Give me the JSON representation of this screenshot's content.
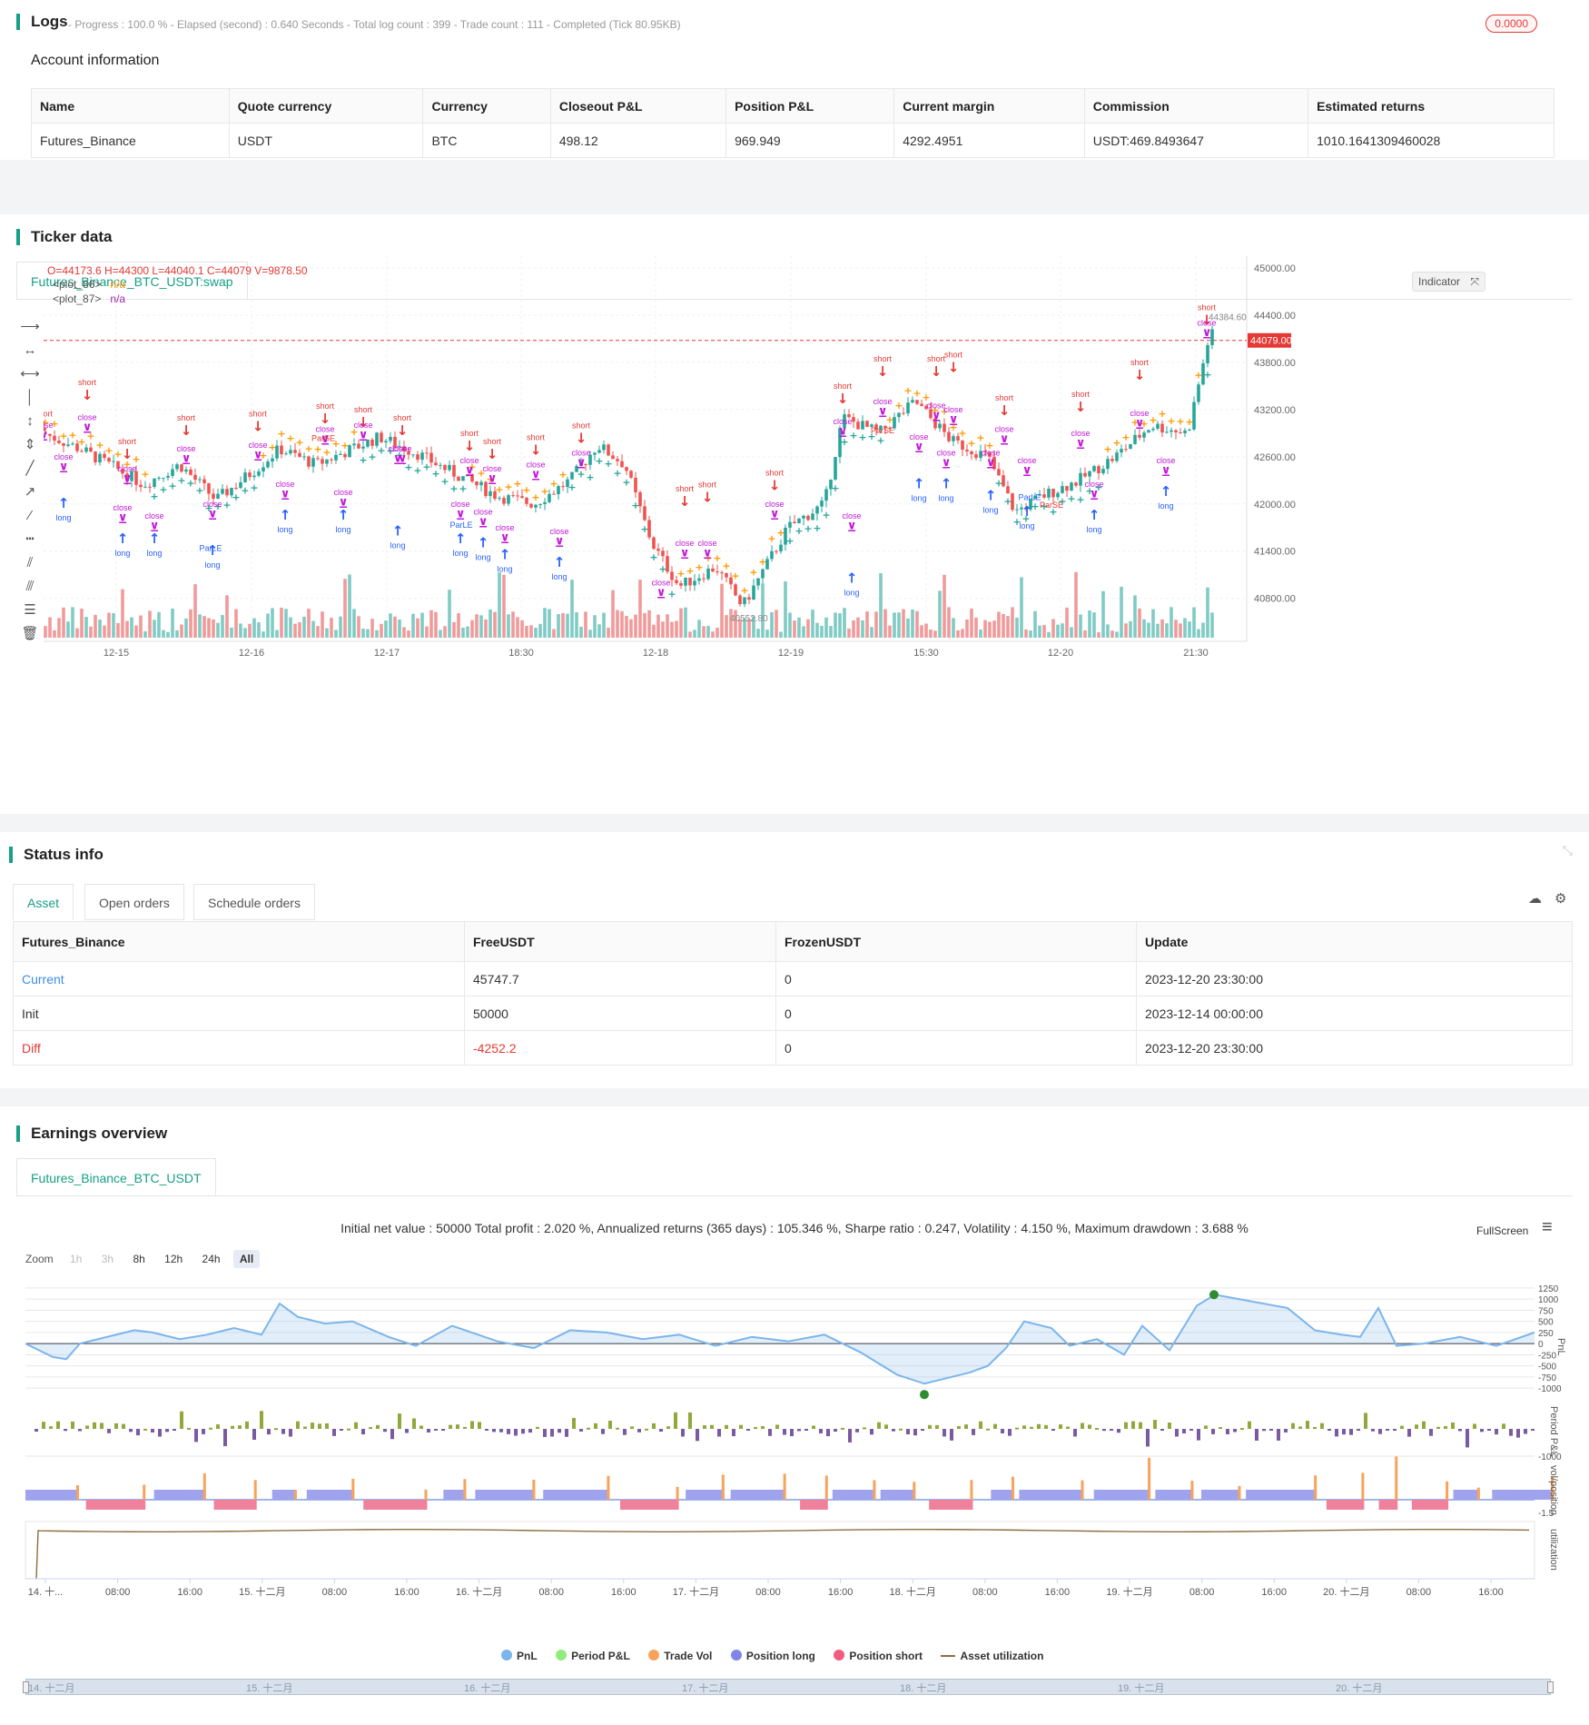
{
  "logs": {
    "title": "Logs",
    "status_line": "- Progress : 100.0 % - Elapsed (second) : 0.640  Seconds - Total log count : 399 - Trade count : 111 - Completed (Tick 80.95KB)",
    "badge": "0.0000"
  },
  "account": {
    "title": "Account information",
    "headers": [
      "Name",
      "Quote currency",
      "Currency",
      "Closeout P&L",
      "Position P&L",
      "Current margin",
      "Commission",
      "Estimated returns"
    ],
    "row": [
      "Futures_Binance",
      "USDT",
      "BTC",
      "498.12",
      "969.949",
      "4292.4951",
      "USDT:469.8493647",
      "1010.1641309460028"
    ]
  },
  "ticker": {
    "title": "Ticker data",
    "tab": "Futures_Binance_BTC_USDT:swap",
    "ohlc": "O=44173.6 H=44300 L=44040.1 C=44079 V=9878.50",
    "plots": [
      {
        "name": "<plot_86>",
        "value": "n/a",
        "color": "#ff9800"
      },
      {
        "name": "<plot_87>",
        "value": "n/a",
        "color": "#9c27b0"
      }
    ],
    "indicator_btn": "Indicator",
    "current_price": "44079.00",
    "high_label": "44384.60",
    "low_label": "40552.80",
    "price_ticks": [
      "45000.00",
      "44400.00",
      "43800.00",
      "43200.00",
      "42600.00",
      "42000.00",
      "41400.00",
      "40800.00"
    ],
    "time_ticks": [
      "12-15",
      "12-16",
      "12-17",
      "18:30",
      "12-18",
      "12-19",
      "15:30",
      "12-20",
      "21:30"
    ],
    "colors": {
      "up": "#26a69a",
      "down": "#ef5350",
      "sar_long": "#26a69a",
      "sar_short": "#ff9800",
      "long": "#2962ff",
      "short": "#e53935",
      "close": "#c118d6"
    },
    "signal_labels": {
      "long": "long",
      "short": "short",
      "close": "close",
      "parle": "ParLE",
      "parse": "ParSE"
    }
  },
  "status": {
    "title": "Status info",
    "tabs": [
      "Asset",
      "Open orders",
      "Schedule orders"
    ],
    "headers": [
      "Futures_Binance",
      "FreeUSDT",
      "FrozenUSDT",
      "Update"
    ],
    "rows": [
      {
        "label": "Current",
        "free": "45747.7",
        "frozen": "0",
        "update": "2023-12-20 23:30:00"
      },
      {
        "label": "Init",
        "free": "50000",
        "frozen": "0",
        "update": "2023-12-14 00:00:00"
      },
      {
        "label": "Diff",
        "free": "-4252.2",
        "frozen": "0",
        "update": "2023-12-20 23:30:00"
      }
    ]
  },
  "earnings": {
    "title": "Earnings overview",
    "tab": "Futures_Binance_BTC_USDT",
    "summary": "Initial net value : 50000 Total profit : 2.020 %, Annualized returns (365 days) : 105.346 %, Sharpe ratio : 0.247, Volatility : 4.150 %, Maximum drawdown : 3.688 %",
    "fullscreen": "FullScreen",
    "zoom_label": "Zoom",
    "zoom_buttons": [
      "1h",
      "3h",
      "8h",
      "12h",
      "24h",
      "All"
    ],
    "pnl_ticks": [
      "1250",
      "1000",
      "750",
      "500",
      "250",
      "0",
      "-250",
      "-500",
      "-750",
      "-1000"
    ],
    "period_tick": "-1000",
    "vol_tick": "-1.5",
    "axis_titles": [
      "PnL",
      "Period P&L",
      "vol/position",
      "utilization"
    ],
    "time_ticks": [
      "14. 十...",
      "08:00",
      "16:00",
      "15. 十二月",
      "08:00",
      "16:00",
      "16. 十二月",
      "08:00",
      "16:00",
      "17. 十二月",
      "08:00",
      "16:00",
      "18. 十二月",
      "08:00",
      "16:00",
      "19. 十二月",
      "08:00",
      "16:00",
      "20. 十二月",
      "08:00",
      "16:00"
    ],
    "nav_ticks": [
      "14. 十二月",
      "15. 十二月",
      "16. 十二月",
      "17. 十二月",
      "18. 十二月",
      "19. 十二月",
      "20. 十二月"
    ],
    "legend": [
      {
        "name": "PnL",
        "color": "#7cb5ec"
      },
      {
        "name": "Period P&L",
        "color": "#90ed7d"
      },
      {
        "name": "Trade Vol",
        "color": "#f7a35c"
      },
      {
        "name": "Position long",
        "color": "#8085e9"
      },
      {
        "name": "Position short",
        "color": "#f15c80"
      },
      {
        "name": "Asset utilization",
        "color": "#8d6e3f"
      }
    ]
  }
}
